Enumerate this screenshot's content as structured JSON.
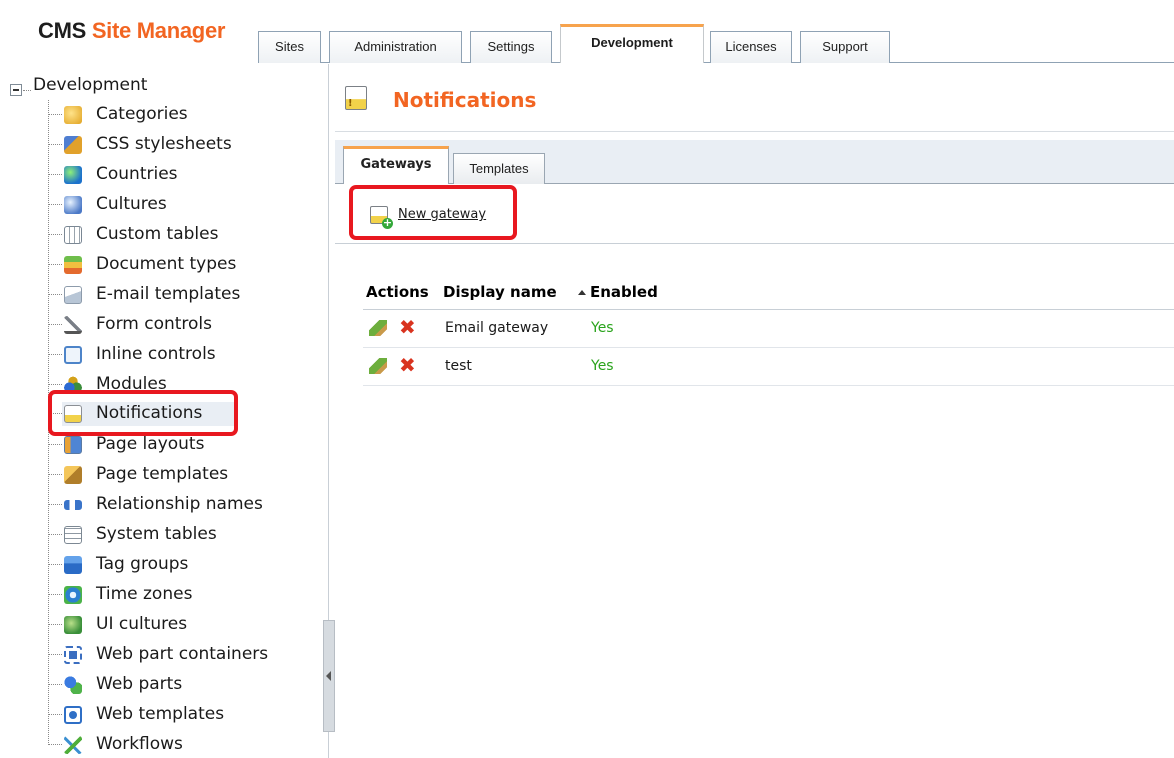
{
  "app": {
    "logo_cms": "CMS",
    "logo_rest": "Site Manager"
  },
  "main_tabs": [
    {
      "label": "Sites"
    },
    {
      "label": "Administration"
    },
    {
      "label": "Settings"
    },
    {
      "label": "Development",
      "active": true
    },
    {
      "label": "Licenses"
    },
    {
      "label": "Support"
    }
  ],
  "tree": {
    "root_label": "Development",
    "items": [
      {
        "label": "Categories",
        "icon": "categories-icon"
      },
      {
        "label": "CSS stylesheets",
        "icon": "css-stylesheets-icon"
      },
      {
        "label": "Countries",
        "icon": "countries-globe-icon"
      },
      {
        "label": "Cultures",
        "icon": "cultures-globe-icon"
      },
      {
        "label": "Custom tables",
        "icon": "custom-tables-icon"
      },
      {
        "label": "Document types",
        "icon": "document-types-icon"
      },
      {
        "label": "E-mail templates",
        "icon": "email-templates-icon"
      },
      {
        "label": "Form controls",
        "icon": "form-controls-icon"
      },
      {
        "label": "Inline controls",
        "icon": "inline-controls-icon"
      },
      {
        "label": "Modules",
        "icon": "modules-icon"
      },
      {
        "label": "Notifications",
        "icon": "notifications-icon",
        "selected": true
      },
      {
        "label": "Page layouts",
        "icon": "page-layouts-icon"
      },
      {
        "label": "Page templates",
        "icon": "page-templates-icon"
      },
      {
        "label": "Relationship names",
        "icon": "relationship-names-icon"
      },
      {
        "label": "System tables",
        "icon": "system-tables-icon"
      },
      {
        "label": "Tag groups",
        "icon": "tag-groups-icon"
      },
      {
        "label": "Time zones",
        "icon": "time-zones-icon"
      },
      {
        "label": "UI cultures",
        "icon": "ui-cultures-icon"
      },
      {
        "label": "Web part containers",
        "icon": "web-part-containers-icon"
      },
      {
        "label": "Web parts",
        "icon": "web-parts-icon"
      },
      {
        "label": "Web templates",
        "icon": "web-templates-icon"
      },
      {
        "label": "Workflows",
        "icon": "workflows-icon"
      }
    ]
  },
  "content": {
    "title": "Notifications",
    "subtabs": [
      {
        "label": "Gateways",
        "active": true
      },
      {
        "label": "Templates"
      }
    ],
    "new_gateway_label": "New gateway",
    "grid": {
      "columns": [
        "Actions",
        "Display name",
        "Enabled"
      ],
      "sorted_column": "Display name",
      "sort_direction": "ascending",
      "rows": [
        {
          "display_name": "Email gateway",
          "enabled": "Yes"
        },
        {
          "display_name": "test",
          "enabled": "Yes"
        }
      ]
    }
  },
  "colors": {
    "brand_orange": "#f26522",
    "active_tab_accent": "#f7a34d",
    "highlight_red": "#e8181f",
    "enabled_green": "#2aa31c",
    "delete_red": "#d9331f"
  }
}
